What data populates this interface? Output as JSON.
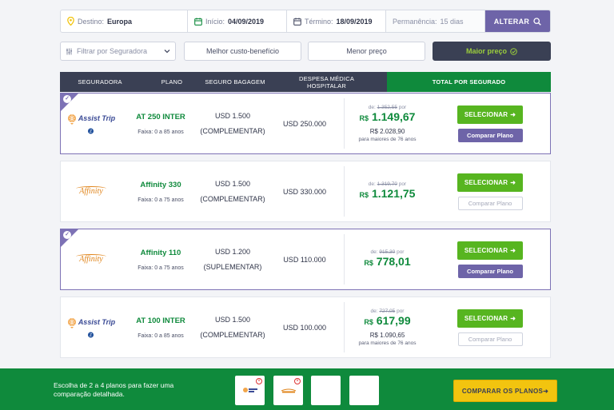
{
  "search": {
    "destino_label": "Destino:",
    "destino_value": "Europa",
    "inicio_label": "Início:",
    "inicio_value": "04/09/2019",
    "termino_label": "Término:",
    "termino_value": "18/09/2019",
    "permanencia_label": "Permanência:",
    "permanencia_value": "15 dias",
    "alterar_label": "ALTERAR"
  },
  "filters": {
    "seguradora_placeholder": "Filtrar por Seguradora",
    "custo_beneficio": "Melhor custo-benefício",
    "menor_preco": "Menor preço",
    "maior_preco": "Maior preço"
  },
  "table_headers": {
    "seguradora": "SEGURADORA",
    "plano": "PLANO",
    "bagagem": "SEGURO BAGAGEM",
    "despesa": "DESPESA MÉDICA HOSPITALAR",
    "total": "TOTAL POR SEGURADO"
  },
  "plans": [
    {
      "insurer": "Assist Trip",
      "name": "AT 250 INTER",
      "faixa": "Faixa: 0 a 85 anos",
      "bagagem": "USD 1.500",
      "bagagem_tipo": "(COMPLEMENTAR)",
      "despesa": "USD 250.000",
      "de_prefix": "de:",
      "de_value": "1.352,55",
      "de_suffix": "por",
      "currency": "R$",
      "price": "1.149,67",
      "alt_price": "R$ 2.028,90",
      "alt_note": "para maiores de 76 anos",
      "selected": true
    },
    {
      "insurer": "Affinity",
      "name": "Affinity 330",
      "faixa": "Faixa: 0 a 75 anos",
      "bagagem": "USD 1.500",
      "bagagem_tipo": "(COMPLEMENTAR)",
      "despesa": "USD 330.000",
      "de_prefix": "de:",
      "de_value": "1.319,70",
      "de_suffix": "por",
      "currency": "R$",
      "price": "1.121,75",
      "selected": false
    },
    {
      "insurer": "Affinity",
      "name": "Affinity 110",
      "faixa": "Faixa: 0 a 75 anos",
      "bagagem": "USD 1.200",
      "bagagem_tipo": "(SUPLEMENTAR)",
      "despesa": "USD 110.000",
      "de_prefix": "de:",
      "de_value": "915,30",
      "de_suffix": "por",
      "currency": "R$",
      "price": "778,01",
      "selected": true
    },
    {
      "insurer": "Assist Trip",
      "name": "AT 100 INTER",
      "faixa": "Faixa: 0 a 85 anos",
      "bagagem": "USD 1.500",
      "bagagem_tipo": "(COMPLEMENTAR)",
      "despesa": "USD 100.000",
      "de_prefix": "de:",
      "de_value": "727,05",
      "de_suffix": "por",
      "currency": "R$",
      "price": "617,99",
      "alt_price": "R$ 1.090,65",
      "alt_note": "para maiores de 76 anos",
      "selected": false
    }
  ],
  "buttons": {
    "selecionar": "SELECIONAR",
    "comparar": "Comparar Plano"
  },
  "footer": {
    "text": "Escolha de 2 a 4 planos para fazer uma comparação detalhada.",
    "compare_button": "COMPARAR OS PLANOS"
  },
  "colors": {
    "green": "#0f8a3c",
    "select_green": "#57b520",
    "purple": "#6e64a8",
    "dark": "#3a4054",
    "yellow": "#f2c40f"
  }
}
